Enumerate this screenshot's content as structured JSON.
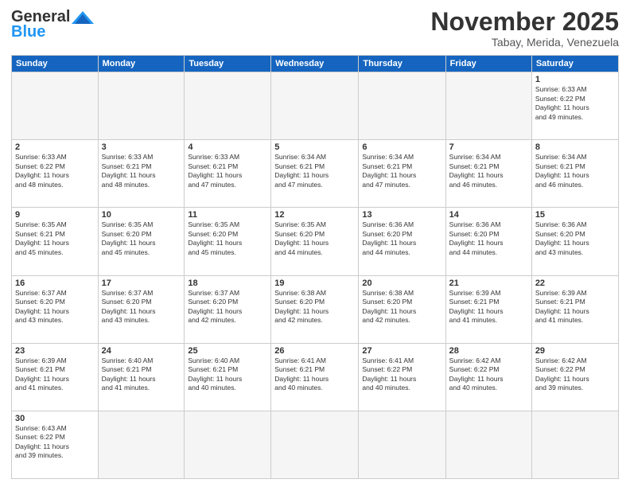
{
  "logo": {
    "general": "General",
    "blue": "Blue"
  },
  "title": "November 2025",
  "location": "Tabay, Merida, Venezuela",
  "days_of_week": [
    "Sunday",
    "Monday",
    "Tuesday",
    "Wednesday",
    "Thursday",
    "Friday",
    "Saturday"
  ],
  "weeks": [
    [
      {
        "day": "",
        "info": ""
      },
      {
        "day": "",
        "info": ""
      },
      {
        "day": "",
        "info": ""
      },
      {
        "day": "",
        "info": ""
      },
      {
        "day": "",
        "info": ""
      },
      {
        "day": "",
        "info": ""
      },
      {
        "day": "1",
        "info": "Sunrise: 6:33 AM\nSunset: 6:22 PM\nDaylight: 11 hours\nand 49 minutes."
      }
    ],
    [
      {
        "day": "2",
        "info": "Sunrise: 6:33 AM\nSunset: 6:22 PM\nDaylight: 11 hours\nand 48 minutes."
      },
      {
        "day": "3",
        "info": "Sunrise: 6:33 AM\nSunset: 6:21 PM\nDaylight: 11 hours\nand 48 minutes."
      },
      {
        "day": "4",
        "info": "Sunrise: 6:33 AM\nSunset: 6:21 PM\nDaylight: 11 hours\nand 47 minutes."
      },
      {
        "day": "5",
        "info": "Sunrise: 6:34 AM\nSunset: 6:21 PM\nDaylight: 11 hours\nand 47 minutes."
      },
      {
        "day": "6",
        "info": "Sunrise: 6:34 AM\nSunset: 6:21 PM\nDaylight: 11 hours\nand 47 minutes."
      },
      {
        "day": "7",
        "info": "Sunrise: 6:34 AM\nSunset: 6:21 PM\nDaylight: 11 hours\nand 46 minutes."
      },
      {
        "day": "8",
        "info": "Sunrise: 6:34 AM\nSunset: 6:21 PM\nDaylight: 11 hours\nand 46 minutes."
      }
    ],
    [
      {
        "day": "9",
        "info": "Sunrise: 6:35 AM\nSunset: 6:21 PM\nDaylight: 11 hours\nand 45 minutes."
      },
      {
        "day": "10",
        "info": "Sunrise: 6:35 AM\nSunset: 6:20 PM\nDaylight: 11 hours\nand 45 minutes."
      },
      {
        "day": "11",
        "info": "Sunrise: 6:35 AM\nSunset: 6:20 PM\nDaylight: 11 hours\nand 45 minutes."
      },
      {
        "day": "12",
        "info": "Sunrise: 6:35 AM\nSunset: 6:20 PM\nDaylight: 11 hours\nand 44 minutes."
      },
      {
        "day": "13",
        "info": "Sunrise: 6:36 AM\nSunset: 6:20 PM\nDaylight: 11 hours\nand 44 minutes."
      },
      {
        "day": "14",
        "info": "Sunrise: 6:36 AM\nSunset: 6:20 PM\nDaylight: 11 hours\nand 44 minutes."
      },
      {
        "day": "15",
        "info": "Sunrise: 6:36 AM\nSunset: 6:20 PM\nDaylight: 11 hours\nand 43 minutes."
      }
    ],
    [
      {
        "day": "16",
        "info": "Sunrise: 6:37 AM\nSunset: 6:20 PM\nDaylight: 11 hours\nand 43 minutes."
      },
      {
        "day": "17",
        "info": "Sunrise: 6:37 AM\nSunset: 6:20 PM\nDaylight: 11 hours\nand 43 minutes."
      },
      {
        "day": "18",
        "info": "Sunrise: 6:37 AM\nSunset: 6:20 PM\nDaylight: 11 hours\nand 42 minutes."
      },
      {
        "day": "19",
        "info": "Sunrise: 6:38 AM\nSunset: 6:20 PM\nDaylight: 11 hours\nand 42 minutes."
      },
      {
        "day": "20",
        "info": "Sunrise: 6:38 AM\nSunset: 6:20 PM\nDaylight: 11 hours\nand 42 minutes."
      },
      {
        "day": "21",
        "info": "Sunrise: 6:39 AM\nSunset: 6:21 PM\nDaylight: 11 hours\nand 41 minutes."
      },
      {
        "day": "22",
        "info": "Sunrise: 6:39 AM\nSunset: 6:21 PM\nDaylight: 11 hours\nand 41 minutes."
      }
    ],
    [
      {
        "day": "23",
        "info": "Sunrise: 6:39 AM\nSunset: 6:21 PM\nDaylight: 11 hours\nand 41 minutes."
      },
      {
        "day": "24",
        "info": "Sunrise: 6:40 AM\nSunset: 6:21 PM\nDaylight: 11 hours\nand 41 minutes."
      },
      {
        "day": "25",
        "info": "Sunrise: 6:40 AM\nSunset: 6:21 PM\nDaylight: 11 hours\nand 40 minutes."
      },
      {
        "day": "26",
        "info": "Sunrise: 6:41 AM\nSunset: 6:21 PM\nDaylight: 11 hours\nand 40 minutes."
      },
      {
        "day": "27",
        "info": "Sunrise: 6:41 AM\nSunset: 6:22 PM\nDaylight: 11 hours\nand 40 minutes."
      },
      {
        "day": "28",
        "info": "Sunrise: 6:42 AM\nSunset: 6:22 PM\nDaylight: 11 hours\nand 40 minutes."
      },
      {
        "day": "29",
        "info": "Sunrise: 6:42 AM\nSunset: 6:22 PM\nDaylight: 11 hours\nand 39 minutes."
      }
    ],
    [
      {
        "day": "30",
        "info": "Sunrise: 6:43 AM\nSunset: 6:22 PM\nDaylight: 11 hours\nand 39 minutes."
      },
      {
        "day": "",
        "info": ""
      },
      {
        "day": "",
        "info": ""
      },
      {
        "day": "",
        "info": ""
      },
      {
        "day": "",
        "info": ""
      },
      {
        "day": "",
        "info": ""
      },
      {
        "day": "",
        "info": ""
      }
    ]
  ]
}
